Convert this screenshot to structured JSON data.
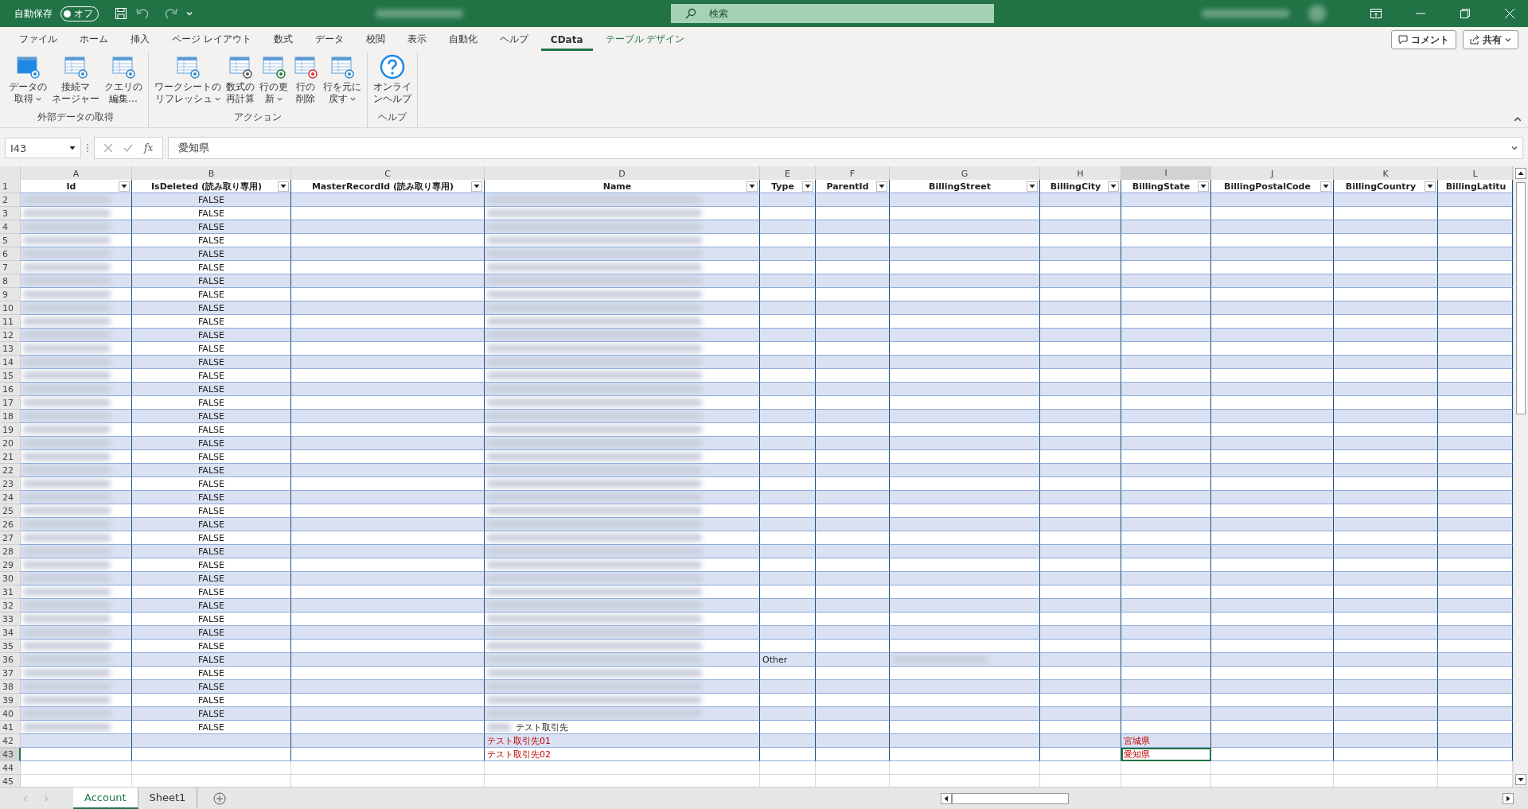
{
  "title_bar": {
    "autosave_label": "自動保存",
    "autosave_toggle": {
      "label": "オフ",
      "on": false
    },
    "title_redacted": true,
    "search": {
      "placeholder": "検索"
    },
    "user_redacted": true
  },
  "ribbon": {
    "tabs": [
      {
        "label": "ファイル",
        "selected": false,
        "kind": "normal"
      },
      {
        "label": "ホーム",
        "selected": false,
        "kind": "normal"
      },
      {
        "label": "挿入",
        "selected": false,
        "kind": "normal"
      },
      {
        "label": "ページ レイアウト",
        "selected": false,
        "kind": "normal"
      },
      {
        "label": "数式",
        "selected": false,
        "kind": "normal"
      },
      {
        "label": "データ",
        "selected": false,
        "kind": "normal"
      },
      {
        "label": "校閲",
        "selected": false,
        "kind": "normal"
      },
      {
        "label": "表示",
        "selected": false,
        "kind": "normal"
      },
      {
        "label": "自動化",
        "selected": false,
        "kind": "normal"
      },
      {
        "label": "ヘルプ",
        "selected": false,
        "kind": "normal"
      },
      {
        "label": "CData",
        "selected": true,
        "kind": "normal"
      },
      {
        "label": "テーブル デザイン",
        "selected": false,
        "kind": "contextual"
      }
    ],
    "actions": [
      {
        "label": "コメント",
        "kind": "comment"
      },
      {
        "label": "共有",
        "kind": "share"
      }
    ],
    "groups": [
      {
        "label": "外部データの取得",
        "buttons": [
          {
            "lines": [
              "データの",
              "取得"
            ],
            "dropdown": true,
            "kind": "cloud"
          },
          {
            "lines": [
              "接続マ",
              "ネージャー"
            ],
            "dropdown": false,
            "kind": "database"
          },
          {
            "lines": [
              "クエリの",
              "編集..."
            ],
            "dropdown": false,
            "kind": "edit"
          }
        ]
      },
      {
        "label": "アクション",
        "buttons": [
          {
            "lines": [
              "ワークシートの",
              "リフレッシュ"
            ],
            "dropdown": true,
            "kind": "refresh"
          },
          {
            "lines": [
              "数式の",
              "再計算"
            ],
            "dropdown": false,
            "kind": "calc"
          },
          {
            "lines": [
              "行の更",
              "新"
            ],
            "dropdown": true,
            "kind": "update"
          },
          {
            "lines": [
              "行の",
              "削除"
            ],
            "dropdown": false,
            "kind": "delete"
          },
          {
            "lines": [
              "行を元に",
              "戻す"
            ],
            "dropdown": true,
            "kind": "undo"
          }
        ]
      },
      {
        "label": "ヘルプ",
        "buttons": [
          {
            "lines": [
              "オンライ",
              "ンヘルプ"
            ],
            "dropdown": false,
            "kind": "help"
          }
        ]
      }
    ]
  },
  "formula_bar": {
    "name_box": "I43",
    "function_label": "fx",
    "formula": "愛知県"
  },
  "table": {
    "columns": [
      {
        "letter": "A",
        "header": "Id",
        "selected": false
      },
      {
        "letter": "B",
        "header": "IsDeleted (読み取り専用)",
        "selected": false
      },
      {
        "letter": "C",
        "header": "MasterRecordId (読み取り専用)",
        "selected": false
      },
      {
        "letter": "D",
        "header": "Name",
        "selected": false
      },
      {
        "letter": "E",
        "header": "Type",
        "selected": false
      },
      {
        "letter": "F",
        "header": "ParentId",
        "selected": false
      },
      {
        "letter": "G",
        "header": "BillingStreet",
        "selected": false
      },
      {
        "letter": "H",
        "header": "BillingCity",
        "selected": false
      },
      {
        "letter": "I",
        "header": "BillingState",
        "selected": true
      },
      {
        "letter": "J",
        "header": "BillingPostalCode",
        "selected": false
      },
      {
        "letter": "K",
        "header": "BillingCountry",
        "selected": false
      },
      {
        "letter": "L",
        "header": "BillingLatitu",
        "selected": false
      }
    ],
    "header_row": "1",
    "rows": [
      {
        "number": "2",
        "selected": false,
        "kind": "existing",
        "cells": {
          "B": "FALSE"
        },
        "redacted": {
          "A": true,
          "D": true
        }
      },
      {
        "number": "3",
        "selected": false,
        "kind": "existing",
        "cells": {
          "B": "FALSE"
        },
        "redacted": {
          "A": true,
          "D": true
        }
      },
      {
        "number": "4",
        "selected": false,
        "kind": "existing",
        "cells": {
          "B": "FALSE"
        },
        "redacted": {
          "A": true,
          "D": true
        }
      },
      {
        "number": "5",
        "selected": false,
        "kind": "existing",
        "cells": {
          "B": "FALSE"
        },
        "redacted": {
          "A": true,
          "D": true
        }
      },
      {
        "number": "6",
        "selected": false,
        "kind": "existing",
        "cells": {
          "B": "FALSE"
        },
        "redacted": {
          "A": true,
          "D": true
        }
      },
      {
        "number": "7",
        "selected": false,
        "kind": "existing",
        "cells": {
          "B": "FALSE"
        },
        "redacted": {
          "A": true,
          "D": true
        }
      },
      {
        "number": "8",
        "selected": false,
        "kind": "existing",
        "cells": {
          "B": "FALSE"
        },
        "redacted": {
          "A": true,
          "D": true
        }
      },
      {
        "number": "9",
        "selected": false,
        "kind": "existing",
        "cells": {
          "B": "FALSE"
        },
        "redacted": {
          "A": true,
          "D": true
        }
      },
      {
        "number": "10",
        "selected": false,
        "kind": "existing",
        "cells": {
          "B": "FALSE"
        },
        "redacted": {
          "A": true,
          "D": true
        }
      },
      {
        "number": "11",
        "selected": false,
        "kind": "existing",
        "cells": {
          "B": "FALSE"
        },
        "redacted": {
          "A": true,
          "D": true
        }
      },
      {
        "number": "12",
        "selected": false,
        "kind": "existing",
        "cells": {
          "B": "FALSE"
        },
        "redacted": {
          "A": true,
          "D": true
        }
      },
      {
        "number": "13",
        "selected": false,
        "kind": "existing",
        "cells": {
          "B": "FALSE"
        },
        "redacted": {
          "A": true,
          "D": true
        }
      },
      {
        "number": "14",
        "selected": false,
        "kind": "existing",
        "cells": {
          "B": "FALSE"
        },
        "redacted": {
          "A": true,
          "D": true
        }
      },
      {
        "number": "15",
        "selected": false,
        "kind": "existing",
        "cells": {
          "B": "FALSE"
        },
        "redacted": {
          "A": true,
          "D": true
        }
      },
      {
        "number": "16",
        "selected": false,
        "kind": "existing",
        "cells": {
          "B": "FALSE"
        },
        "redacted": {
          "A": true,
          "D": true
        }
      },
      {
        "number": "17",
        "selected": false,
        "kind": "existing",
        "cells": {
          "B": "FALSE"
        },
        "redacted": {
          "A": true,
          "D": true
        }
      },
      {
        "number": "18",
        "selected": false,
        "kind": "existing",
        "cells": {
          "B": "FALSE"
        },
        "redacted": {
          "A": true,
          "D": true
        }
      },
      {
        "number": "19",
        "selected": false,
        "kind": "existing",
        "cells": {
          "B": "FALSE"
        },
        "redacted": {
          "A": true,
          "D": true
        }
      },
      {
        "number": "20",
        "selected": false,
        "kind": "existing",
        "cells": {
          "B": "FALSE"
        },
        "redacted": {
          "A": true,
          "D": true
        }
      },
      {
        "number": "21",
        "selected": false,
        "kind": "existing",
        "cells": {
          "B": "FALSE"
        },
        "redacted": {
          "A": true,
          "D": true
        }
      },
      {
        "number": "22",
        "selected": false,
        "kind": "existing",
        "cells": {
          "B": "FALSE"
        },
        "redacted": {
          "A": true,
          "D": true
        }
      },
      {
        "number": "23",
        "selected": false,
        "kind": "existing",
        "cells": {
          "B": "FALSE"
        },
        "redacted": {
          "A": true,
          "D": true
        }
      },
      {
        "number": "24",
        "selected": false,
        "kind": "existing",
        "cells": {
          "B": "FALSE"
        },
        "redacted": {
          "A": true,
          "D": true
        }
      },
      {
        "number": "25",
        "selected": false,
        "kind": "existing",
        "cells": {
          "B": "FALSE"
        },
        "redacted": {
          "A": true,
          "D": true
        }
      },
      {
        "number": "26",
        "selected": false,
        "kind": "existing",
        "cells": {
          "B": "FALSE"
        },
        "redacted": {
          "A": true,
          "D": true
        }
      },
      {
        "number": "27",
        "selected": false,
        "kind": "existing",
        "cells": {
          "B": "FALSE"
        },
        "redacted": {
          "A": true,
          "D": true
        }
      },
      {
        "number": "28",
        "selected": false,
        "kind": "existing",
        "cells": {
          "B": "FALSE"
        },
        "redacted": {
          "A": true,
          "D": true
        }
      },
      {
        "number": "29",
        "selected": false,
        "kind": "existing",
        "cells": {
          "B": "FALSE"
        },
        "redacted": {
          "A": true,
          "D": true
        }
      },
      {
        "number": "30",
        "selected": false,
        "kind": "existing",
        "cells": {
          "B": "FALSE"
        },
        "redacted": {
          "A": true,
          "D": true
        }
      },
      {
        "number": "31",
        "selected": false,
        "kind": "existing",
        "cells": {
          "B": "FALSE"
        },
        "redacted": {
          "A": true,
          "D": true
        }
      },
      {
        "number": "32",
        "selected": false,
        "kind": "existing",
        "cells": {
          "B": "FALSE"
        },
        "redacted": {
          "A": true,
          "D": true
        }
      },
      {
        "number": "33",
        "selected": false,
        "kind": "existing",
        "cells": {
          "B": "FALSE"
        },
        "redacted": {
          "A": true,
          "D": true
        }
      },
      {
        "number": "34",
        "selected": false,
        "kind": "existing",
        "cells": {
          "B": "FALSE"
        },
        "redacted": {
          "A": true,
          "D": true
        }
      },
      {
        "number": "35",
        "selected": false,
        "kind": "existing",
        "cells": {
          "B": "FALSE"
        },
        "redacted": {
          "A": true,
          "D": true
        }
      },
      {
        "number": "36",
        "selected": false,
        "kind": "existing",
        "cells": {
          "B": "FALSE",
          "E": "Other"
        },
        "redacted": {
          "A": true,
          "D": true,
          "G": true
        }
      },
      {
        "number": "37",
        "selected": false,
        "kind": "existing",
        "cells": {
          "B": "FALSE"
        },
        "redacted": {
          "A": true,
          "D": true
        }
      },
      {
        "number": "38",
        "selected": false,
        "kind": "existing",
        "cells": {
          "B": "FALSE"
        },
        "redacted": {
          "A": true,
          "D": true
        }
      },
      {
        "number": "39",
        "selected": false,
        "kind": "existing",
        "cells": {
          "B": "FALSE"
        },
        "redacted": {
          "A": true,
          "D": true
        }
      },
      {
        "number": "40",
        "selected": false,
        "kind": "existing",
        "cells": {
          "B": "FALSE"
        },
        "redacted": {
          "A": true,
          "D": true
        }
      },
      {
        "number": "41",
        "selected": false,
        "kind": "existing",
        "cells": {
          "B": "FALSE",
          "D": "テスト取引先"
        },
        "redacted": {
          "A": true,
          "D": true
        }
      },
      {
        "number": "42",
        "selected": false,
        "kind": "new",
        "cells": {
          "D": "テスト取引先01",
          "I": "宮城県"
        }
      },
      {
        "number": "43",
        "selected": true,
        "kind": "new",
        "cells": {
          "D": "テスト取引先02",
          "I": "愛知県"
        }
      }
    ],
    "empty_rows": [
      "44",
      "45"
    ]
  },
  "sheet_tabs": [
    {
      "label": "Account",
      "selected": true
    },
    {
      "label": "Sheet1",
      "selected": false
    }
  ]
}
